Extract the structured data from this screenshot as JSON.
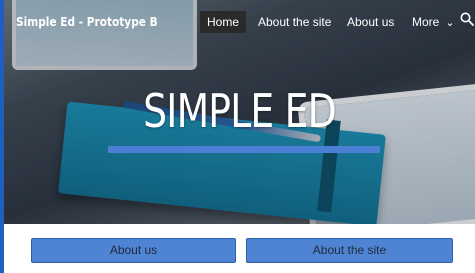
{
  "brand": {
    "title": "Simple Ed - Prototype B"
  },
  "nav": {
    "items": [
      {
        "label": "Home",
        "active": true
      },
      {
        "label": "About the site",
        "active": false
      },
      {
        "label": "About us",
        "active": false
      },
      {
        "label": "More",
        "active": false
      }
    ],
    "more_icon": "chevron-down-icon",
    "search_icon": "search-icon"
  },
  "hero": {
    "title": "SIMPLE ED"
  },
  "buttons": {
    "about_us": "About us",
    "about_site": "About the site"
  },
  "colors": {
    "accent": "#4a7fd4",
    "button_bg": "#4f83d3",
    "nav_active_bg": "#2a2a2a",
    "frame": "#1f5fbf"
  }
}
